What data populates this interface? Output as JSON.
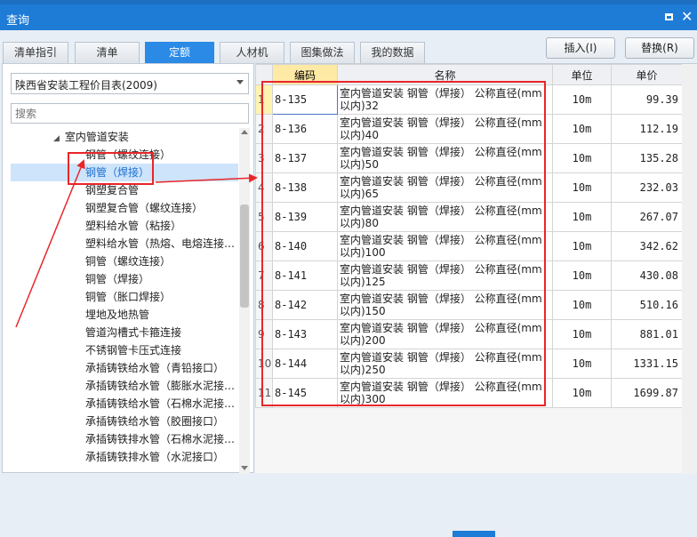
{
  "window": {
    "title": "查询"
  },
  "tabs": [
    {
      "label": "清单指引"
    },
    {
      "label": "清单"
    },
    {
      "label": "定额"
    },
    {
      "label": "人材机"
    },
    {
      "label": "图集做法"
    },
    {
      "label": "我的数据"
    }
  ],
  "actions": {
    "insert_label": "插入(I)",
    "replace_label": "替换(R)"
  },
  "library": {
    "selected": "陕西省安装工程价目表(2009)"
  },
  "search": {
    "placeholder": "搜索"
  },
  "tree": {
    "items": [
      "室内管道安装",
      "钢管（螺纹连接）",
      "钢管（焊接）",
      "钢塑复合管",
      "钢塑复合管（螺纹连接）",
      "塑料给水管（粘接）",
      "塑料给水管（热熔、电熔连接…",
      "铜管（螺纹连接）",
      "铜管（焊接）",
      "铜管（胀口焊接）",
      "埋地及地热管",
      "管道沟槽式卡箍连接",
      "不锈钢管卡压式连接",
      "承插铸铁给水管（青铅接口）",
      "承插铸铁给水管（膨胀水泥接…",
      "承插铸铁给水管（石棉水泥接…",
      "承插铸铁给水管（胶圈接口）",
      "承插铸铁排水管（石棉水泥接…",
      "承插铸铁排水管（水泥接口）"
    ]
  },
  "table": {
    "columns": [
      "编码",
      "名称",
      "单位",
      "单价"
    ],
    "rows": [
      {
        "idx": "1",
        "code": "8-135",
        "name": "室内管道安装 钢管（焊接） 公称直径(mm以内)32",
        "unit": "10m",
        "price": "99.39"
      },
      {
        "idx": "2",
        "code": "8-136",
        "name": "室内管道安装 钢管（焊接） 公称直径(mm以内)40",
        "unit": "10m",
        "price": "112.19"
      },
      {
        "idx": "3",
        "code": "8-137",
        "name": "室内管道安装 钢管（焊接） 公称直径(mm以内)50",
        "unit": "10m",
        "price": "135.28"
      },
      {
        "idx": "4",
        "code": "8-138",
        "name": "室内管道安装 钢管（焊接） 公称直径(mm以内)65",
        "unit": "10m",
        "price": "232.03"
      },
      {
        "idx": "5",
        "code": "8-139",
        "name": "室内管道安装 钢管（焊接） 公称直径(mm以内)80",
        "unit": "10m",
        "price": "267.07"
      },
      {
        "idx": "6",
        "code": "8-140",
        "name": "室内管道安装 钢管（焊接） 公称直径(mm以内)100",
        "unit": "10m",
        "price": "342.62"
      },
      {
        "idx": "7",
        "code": "8-141",
        "name": "室内管道安装 钢管（焊接） 公称直径(mm以内)125",
        "unit": "10m",
        "price": "430.08"
      },
      {
        "idx": "8",
        "code": "8-142",
        "name": "室内管道安装 钢管（焊接） 公称直径(mm以内)150",
        "unit": "10m",
        "price": "510.16"
      },
      {
        "idx": "9",
        "code": "8-143",
        "name": "室内管道安装 钢管（焊接） 公称直径(mm以内)200",
        "unit": "10m",
        "price": "881.01"
      },
      {
        "idx": "10",
        "code": "8-144",
        "name": "室内管道安装 钢管（焊接） 公称直径(mm以内)250",
        "unit": "10m",
        "price": "1331.15"
      },
      {
        "idx": "11",
        "code": "8-145",
        "name": "室内管道安装 钢管（焊接） 公称直径(mm以内)300",
        "unit": "10m",
        "price": "1699.87"
      }
    ]
  },
  "colors": {
    "accent": "#1e7bd6",
    "annotation": "#e8262a",
    "selection": "#cde4fa"
  }
}
